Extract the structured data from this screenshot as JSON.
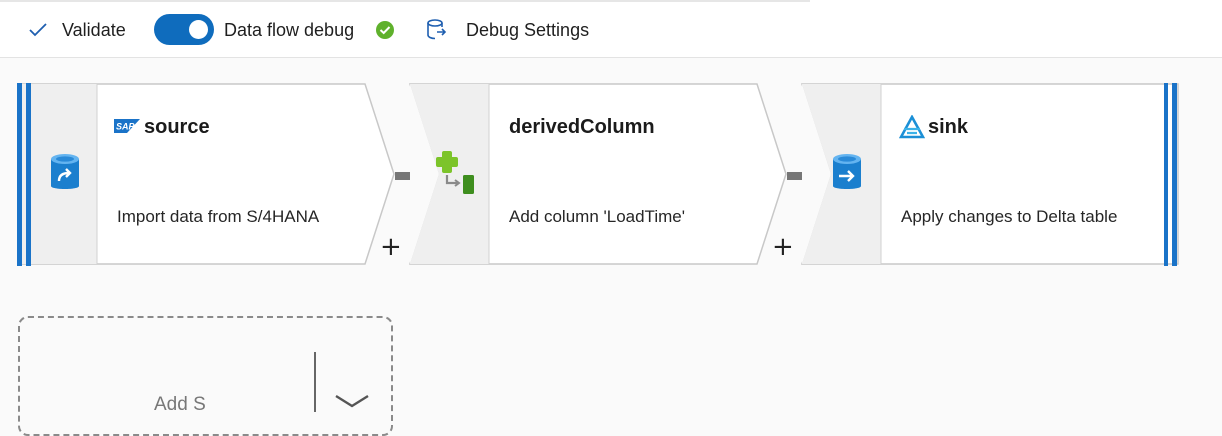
{
  "toolbar": {
    "validate_label": "Validate",
    "data_flow_debug_label": "Data flow debug",
    "data_flow_debug_on": true,
    "debug_settings_label": "Debug Settings"
  },
  "nodes": [
    {
      "title": "source",
      "description": "Import data from S/4HANA",
      "icon": "database-source-icon",
      "brand": "SAP"
    },
    {
      "title": "derivedColumn",
      "description": "Add column 'LoadTime'",
      "icon": "derived-column-icon"
    },
    {
      "title": "sink",
      "description": "Apply changes to Delta table",
      "icon": "database-sink-icon",
      "brand": "synapse-icon"
    }
  ],
  "add_source": {
    "label": "Add S"
  },
  "colors": {
    "accent": "#0f6cbd",
    "node_bar": "#1a73c8",
    "success": "#5fb12c",
    "icon_blue": "#1b7fce",
    "connector": "#767676"
  }
}
